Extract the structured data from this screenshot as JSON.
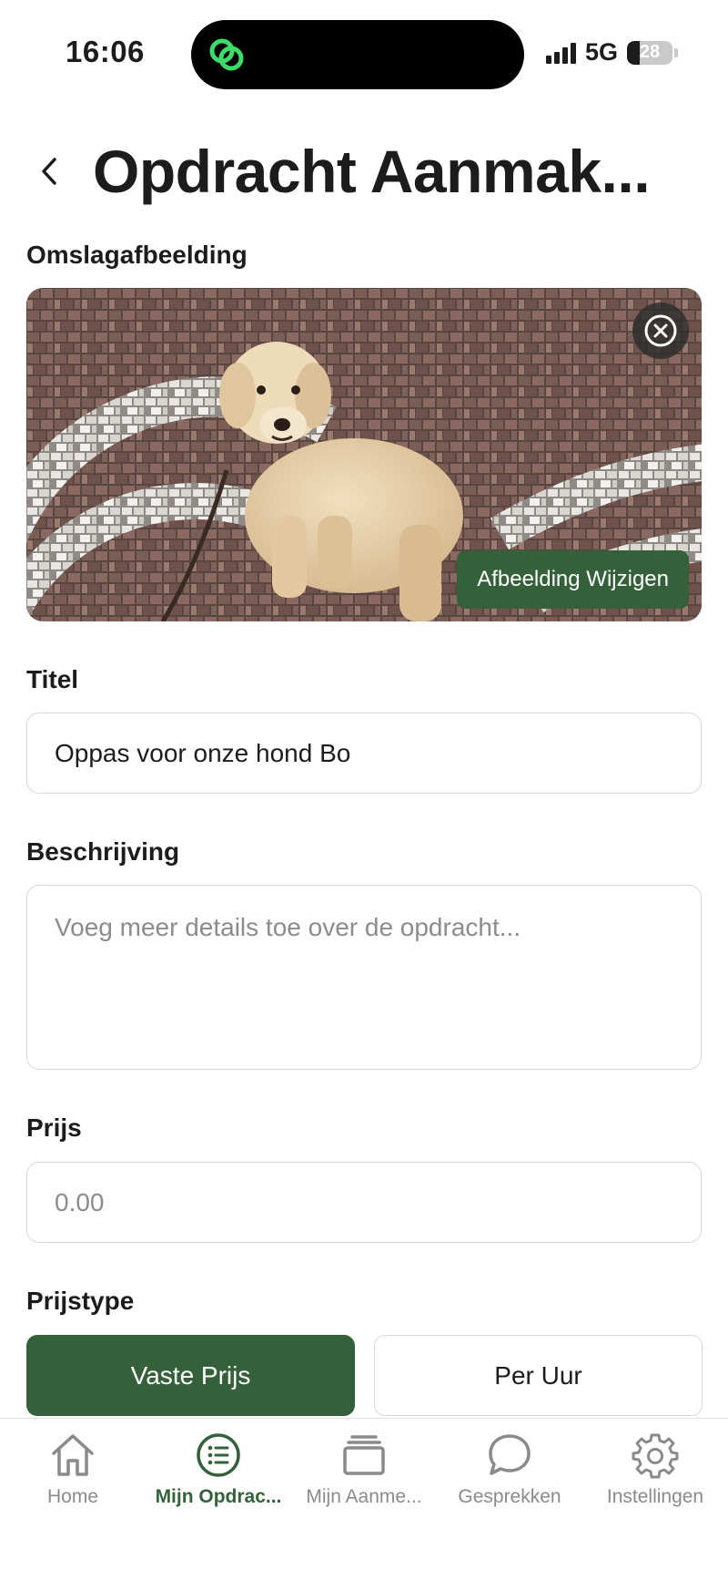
{
  "status_bar": {
    "time": "16:06",
    "network": "5G",
    "battery": "28",
    "battery_level": 0.28,
    "signal_bars": 4
  },
  "header": {
    "title": "Opdracht Aanmak..."
  },
  "cover": {
    "label": "Omslagafbeelding",
    "change_label": "Afbeelding Wijzigen"
  },
  "title_field": {
    "label": "Titel",
    "value": "Oppas voor onze hond Bo"
  },
  "description_field": {
    "label": "Beschrijving",
    "placeholder": "Voeg meer details toe over de opdracht..."
  },
  "price_field": {
    "label": "Prijs",
    "placeholder": "0.00"
  },
  "price_type": {
    "label": "Prijstype",
    "options": [
      "Vaste Prijs",
      "Per Uur"
    ],
    "selected": "Vaste Prijs"
  },
  "tabs": [
    {
      "label": "Home",
      "icon": "house-icon"
    },
    {
      "label": "Mijn Opdrac...",
      "icon": "list-icon"
    },
    {
      "label": "Mijn Aanme...",
      "icon": "stack-icon"
    },
    {
      "label": "Gesprekken",
      "icon": "chat-bubble-icon"
    },
    {
      "label": "Instellingen",
      "icon": "gear-icon"
    }
  ],
  "colors": {
    "accent": "#34613a",
    "island_icon": "#3ddc68",
    "inactive_tab": "#8a8a8a"
  }
}
